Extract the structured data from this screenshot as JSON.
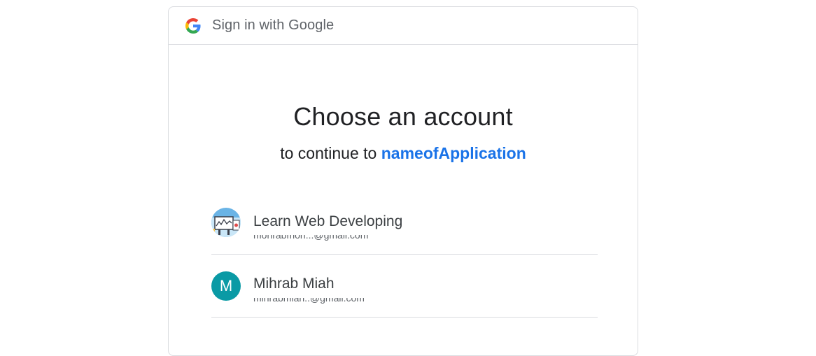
{
  "header": {
    "logo": "google-g-icon",
    "text": "Sign in with Google"
  },
  "main": {
    "title": "Choose an account",
    "subtitle_prefix": "to continue to ",
    "app_name": "nameofApplication"
  },
  "accounts": [
    {
      "name": "Learn Web Developing",
      "avatar": "channel-thumbnail-image"
    },
    {
      "name": "Mihrab Miah",
      "avatar_letter": "M"
    }
  ],
  "colors": {
    "link": "#1a73e8",
    "avatar_bg": "#0a9aa5",
    "divider": "#dadce0"
  }
}
